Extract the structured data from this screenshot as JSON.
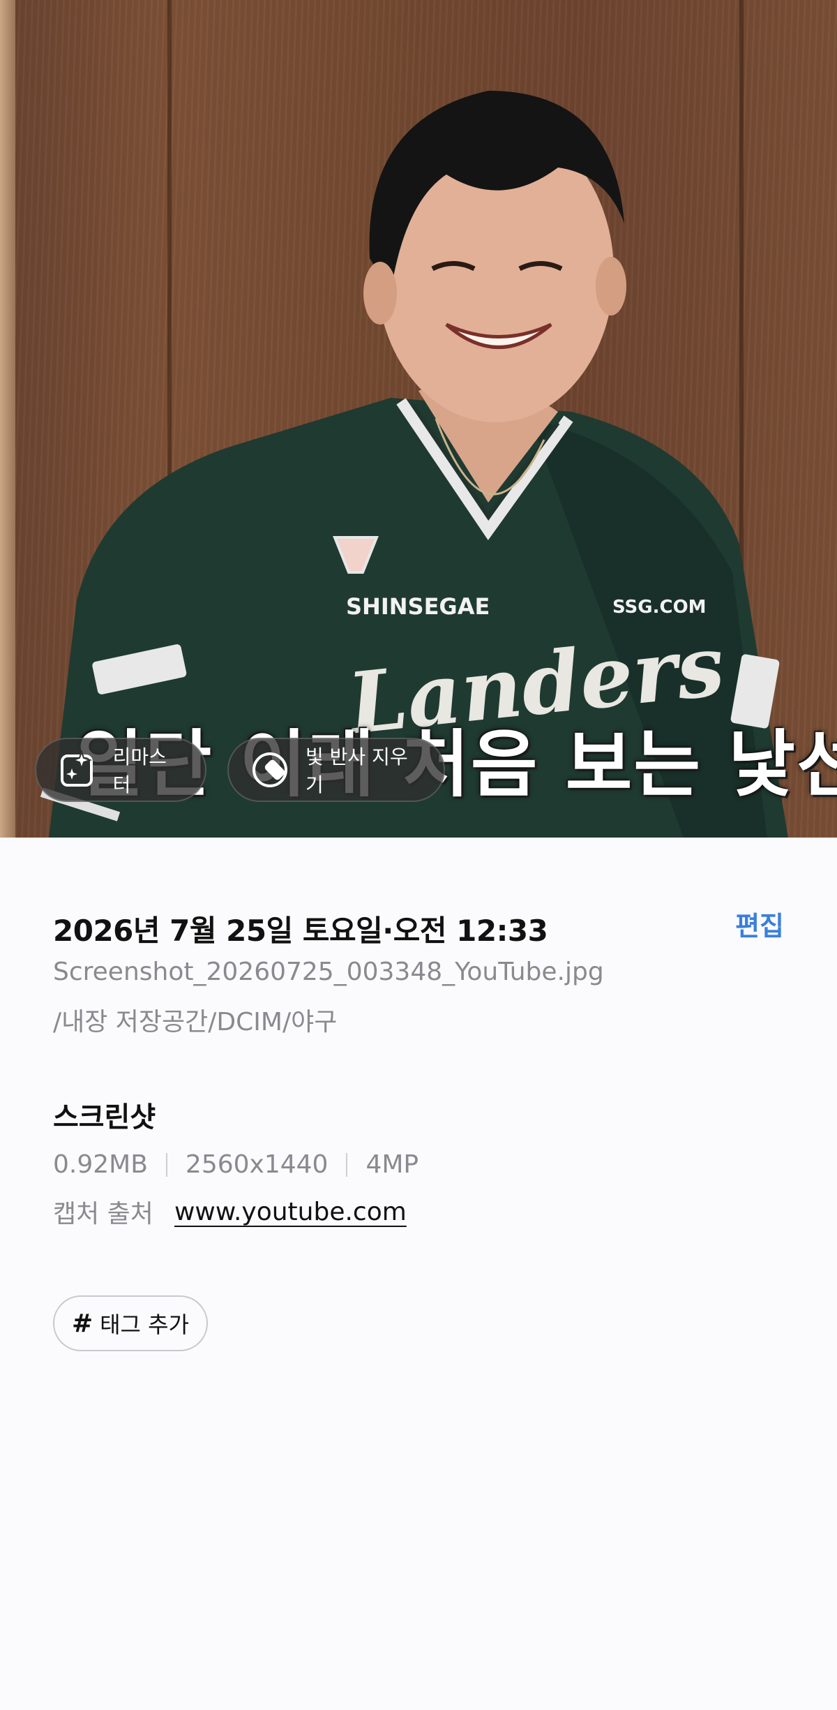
{
  "photo": {
    "jersey_brand": "SHINSEGAE",
    "jersey_sponsor": "SSG.COM",
    "jersey_team": "Landers",
    "burned_subtitle": "일단 이래 처음 보는 낯선 미"
  },
  "photo_actions": {
    "remaster_label": "리마스터",
    "remaster_icon": "sparkle-frame-icon",
    "glare_label": "빛 반사 지우기",
    "glare_icon": "glare-remove-icon"
  },
  "details": {
    "date_time": "2026년 7월 25일 토요일·오전 12:33",
    "edit_label": "편집",
    "filename": "Screenshot_20260725_003348_YouTube.jpg",
    "path": "/내장 저장공간/DCIM/야구",
    "type_title": "스크린샷",
    "file_size": "0.92MB",
    "resolution": "2560x1440",
    "megapixels": "4MP",
    "source_label": "캡처 출처",
    "source_url": "www.youtube.com",
    "tag_label": "태그 추가",
    "tag_icon": "hash-icon"
  },
  "colors": {
    "accent": "#3a7fdc",
    "jersey": "#1f3a31",
    "background": "#fbfbfd"
  }
}
